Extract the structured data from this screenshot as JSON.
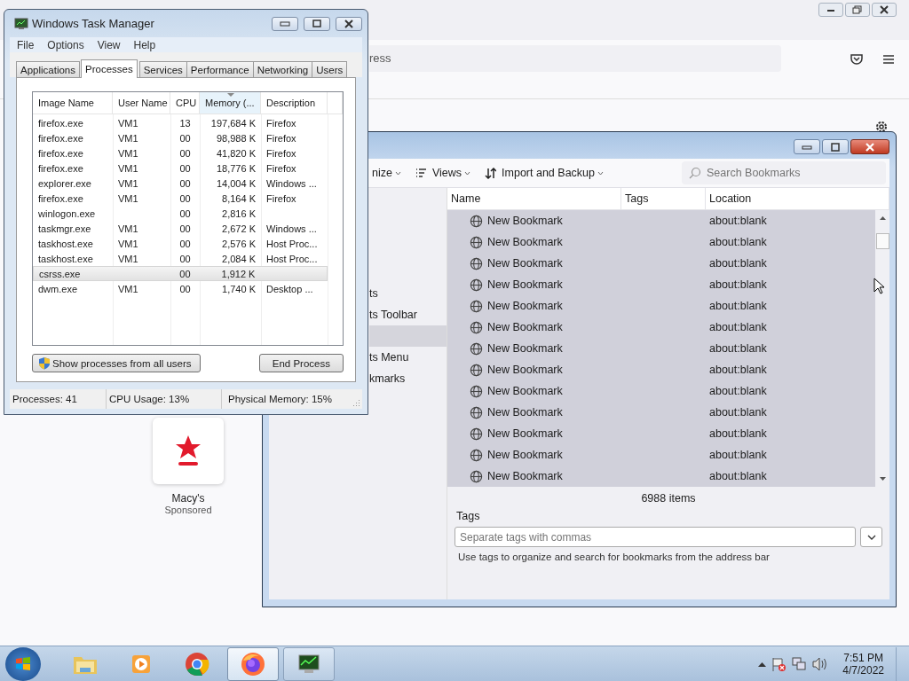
{
  "browser": {
    "address_fragment": "ress",
    "tile": {
      "name": "Macy's",
      "note": "Sponsored"
    }
  },
  "library": {
    "toolbar": [
      {
        "label": "nize",
        "kind": "menu"
      },
      {
        "label": "Views",
        "kind": "views"
      },
      {
        "label": "Import and Backup",
        "kind": "import"
      }
    ],
    "search": {
      "placeholder": "Search Bookmarks"
    },
    "sidebar": [
      {
        "label": "ts",
        "selected": false
      },
      {
        "label": "ts Toolbar",
        "selected": false
      },
      {
        "selected": true
      },
      {
        "label": "ts Menu",
        "selected": false
      },
      {
        "label": "kmarks",
        "selected": false
      }
    ],
    "columns": [
      "Name",
      "Tags",
      "Location"
    ],
    "rows": [
      {
        "name": "New Bookmark",
        "location": "about:blank",
        "selected": true
      },
      {
        "name": "New Bookmark",
        "location": "about:blank",
        "selected": true
      },
      {
        "name": "New Bookmark",
        "location": "about:blank",
        "selected": true
      },
      {
        "name": "New Bookmark",
        "location": "about:blank",
        "selected": true
      },
      {
        "name": "New Bookmark",
        "location": "about:blank",
        "selected": true
      },
      {
        "name": "New Bookmark",
        "location": "about:blank",
        "selected": true
      },
      {
        "name": "New Bookmark",
        "location": "about:blank",
        "selected": true
      },
      {
        "name": "New Bookmark",
        "location": "about:blank",
        "selected": true
      },
      {
        "name": "New Bookmark",
        "location": "about:blank",
        "selected": true
      },
      {
        "name": "New Bookmark",
        "location": "about:blank",
        "selected": true
      },
      {
        "name": "New Bookmark",
        "location": "about:blank",
        "selected": true
      },
      {
        "name": "New Bookmark",
        "location": "about:blank",
        "selected": true
      },
      {
        "name": "New Bookmark",
        "location": "about:blank",
        "selected": true
      }
    ],
    "item_count": "6988 items",
    "tags": {
      "label": "Tags",
      "placeholder": "Separate tags with commas",
      "hint": "Use tags to organize and search for bookmarks from the address bar"
    }
  },
  "task_manager": {
    "title": "Windows Task Manager",
    "menu": [
      "File",
      "Options",
      "View",
      "Help"
    ],
    "tabs": [
      {
        "label": "Applications",
        "selected": false
      },
      {
        "label": "Processes",
        "selected": true
      },
      {
        "label": "Services",
        "selected": false
      },
      {
        "label": "Performance",
        "selected": false
      },
      {
        "label": "Networking",
        "selected": false
      },
      {
        "label": "Users",
        "selected": false
      }
    ],
    "columns": [
      {
        "label": "Image Name",
        "sorted": false
      },
      {
        "label": "User Name",
        "sorted": false
      },
      {
        "label": "CPU",
        "sorted": false
      },
      {
        "label": "Memory (...",
        "sorted": true
      },
      {
        "label": "Description",
        "sorted": false
      }
    ],
    "rows": [
      {
        "image": "firefox.exe",
        "user": "VM1",
        "cpu": "13",
        "memory": "197,684 K",
        "description": "Firefox",
        "selected": false
      },
      {
        "image": "firefox.exe",
        "user": "VM1",
        "cpu": "00",
        "memory": "98,988 K",
        "description": "Firefox",
        "selected": false
      },
      {
        "image": "firefox.exe",
        "user": "VM1",
        "cpu": "00",
        "memory": "41,820 K",
        "description": "Firefox",
        "selected": false
      },
      {
        "image": "firefox.exe",
        "user": "VM1",
        "cpu": "00",
        "memory": "18,776 K",
        "description": "Firefox",
        "selected": false
      },
      {
        "image": "explorer.exe",
        "user": "VM1",
        "cpu": "00",
        "memory": "14,004 K",
        "description": "Windows ...",
        "selected": false
      },
      {
        "image": "firefox.exe",
        "user": "VM1",
        "cpu": "00",
        "memory": "8,164 K",
        "description": "Firefox",
        "selected": false
      },
      {
        "image": "winlogon.exe",
        "cpu": "00",
        "memory": "2,816 K",
        "selected": false
      },
      {
        "image": "taskmgr.exe",
        "user": "VM1",
        "cpu": "00",
        "memory": "2,672 K",
        "description": "Windows ...",
        "selected": false
      },
      {
        "image": "taskhost.exe",
        "user": "VM1",
        "cpu": "00",
        "memory": "2,576 K",
        "description": "Host Proc...",
        "selected": false
      },
      {
        "image": "taskhost.exe",
        "user": "VM1",
        "cpu": "00",
        "memory": "2,084 K",
        "description": "Host Proc...",
        "selected": false
      },
      {
        "image": "csrss.exe",
        "cpu": "00",
        "memory": "1,912 K",
        "selected": true
      },
      {
        "image": "dwm.exe",
        "user": "VM1",
        "cpu": "00",
        "memory": "1,740 K",
        "description": "Desktop ...",
        "selected": false
      }
    ],
    "buttons": [
      {
        "label": "Show processes from all users",
        "kind": "shield"
      },
      {
        "label": "End Process",
        "kind": "plain"
      }
    ],
    "status": [
      "Processes: 41",
      "CPU Usage: 13%",
      "Physical Memory: 15%"
    ]
  },
  "taskbar": {
    "apps": [
      {
        "kind": "explorer",
        "running": false,
        "selected": false
      },
      {
        "kind": "media",
        "running": false,
        "selected": false
      },
      {
        "kind": "chrome",
        "running": false,
        "selected": false
      },
      {
        "kind": "firefox",
        "running": true,
        "selected": true
      },
      {
        "kind": "taskmgr",
        "running": true,
        "selected": false
      }
    ],
    "time": "7:51 PM",
    "date": "4/7/2022"
  }
}
